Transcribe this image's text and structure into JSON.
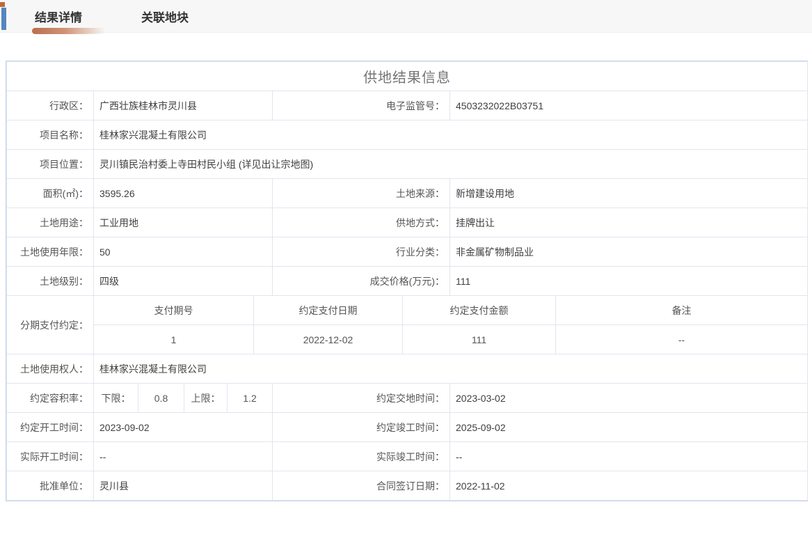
{
  "colors": {
    "accent_orange": "#c06a36",
    "accent_blue": "#5586c1",
    "underline_gradient_from": "#b96f4e",
    "panel_border": "#c2d3e9",
    "cell_border": "#e0e5ee",
    "tabbar_bg": "#f7f7f7"
  },
  "tabbar": {
    "tabs": [
      {
        "label": "结果详情",
        "active": true
      },
      {
        "label": "关联地块",
        "active": false
      }
    ]
  },
  "panel": {
    "title": "供地结果信息",
    "fields": {
      "admin_region": {
        "label": "行政区：",
        "value": "广西壮族桂林市灵川县"
      },
      "supervision_no": {
        "label": "电子监管号：",
        "value": "4503232022B03751"
      },
      "project_name": {
        "label": "项目名称：",
        "value": "桂林家兴混凝土有限公司"
      },
      "project_location": {
        "label": "项目位置：",
        "value": "灵川镇民治村委上寺田村民小组 (详见出让宗地图)"
      },
      "area": {
        "label": "面积(㎡)：",
        "value": "3595.26"
      },
      "land_source": {
        "label": "土地来源：",
        "value": "新增建设用地"
      },
      "land_use": {
        "label": "土地用途：",
        "value": "工业用地"
      },
      "supply_method": {
        "label": "供地方式：",
        "value": "挂牌出让"
      },
      "use_years": {
        "label": "土地使用年限：",
        "value": "50"
      },
      "industry": {
        "label": "行业分类：",
        "value": "非金属矿物制品业"
      },
      "land_grade": {
        "label": "土地级别：",
        "value": "四级"
      },
      "deal_price": {
        "label": "成交价格(万元)：",
        "value": "111"
      },
      "installment": {
        "label": "分期支付约定：",
        "headers": [
          "支付期号",
          "约定支付日期",
          "约定支付金额",
          "备注"
        ],
        "rows": [
          [
            "1",
            "2022-12-02",
            "111",
            "--"
          ]
        ]
      },
      "land_user": {
        "label": "土地使用权人：",
        "value": "桂林家兴混凝土有限公司"
      },
      "plot_ratio": {
        "label": "约定容积率：",
        "lower_label": "下限：",
        "lower_value": "0.8",
        "upper_label": "上限：",
        "upper_value": "1.2"
      },
      "delivery_time": {
        "label": "约定交地时间：",
        "value": "2023-03-02"
      },
      "agreed_start": {
        "label": "约定开工时间：",
        "value": "2023-09-02"
      },
      "agreed_complete": {
        "label": "约定竣工时间：",
        "value": "2025-09-02"
      },
      "actual_start": {
        "label": "实际开工时间：",
        "value": "--"
      },
      "actual_complete": {
        "label": "实际竣工时间：",
        "value": "--"
      },
      "approval_unit": {
        "label": "批准单位：",
        "value": "灵川县"
      },
      "contract_date": {
        "label": "合同签订日期：",
        "value": "2022-11-02"
      }
    }
  }
}
